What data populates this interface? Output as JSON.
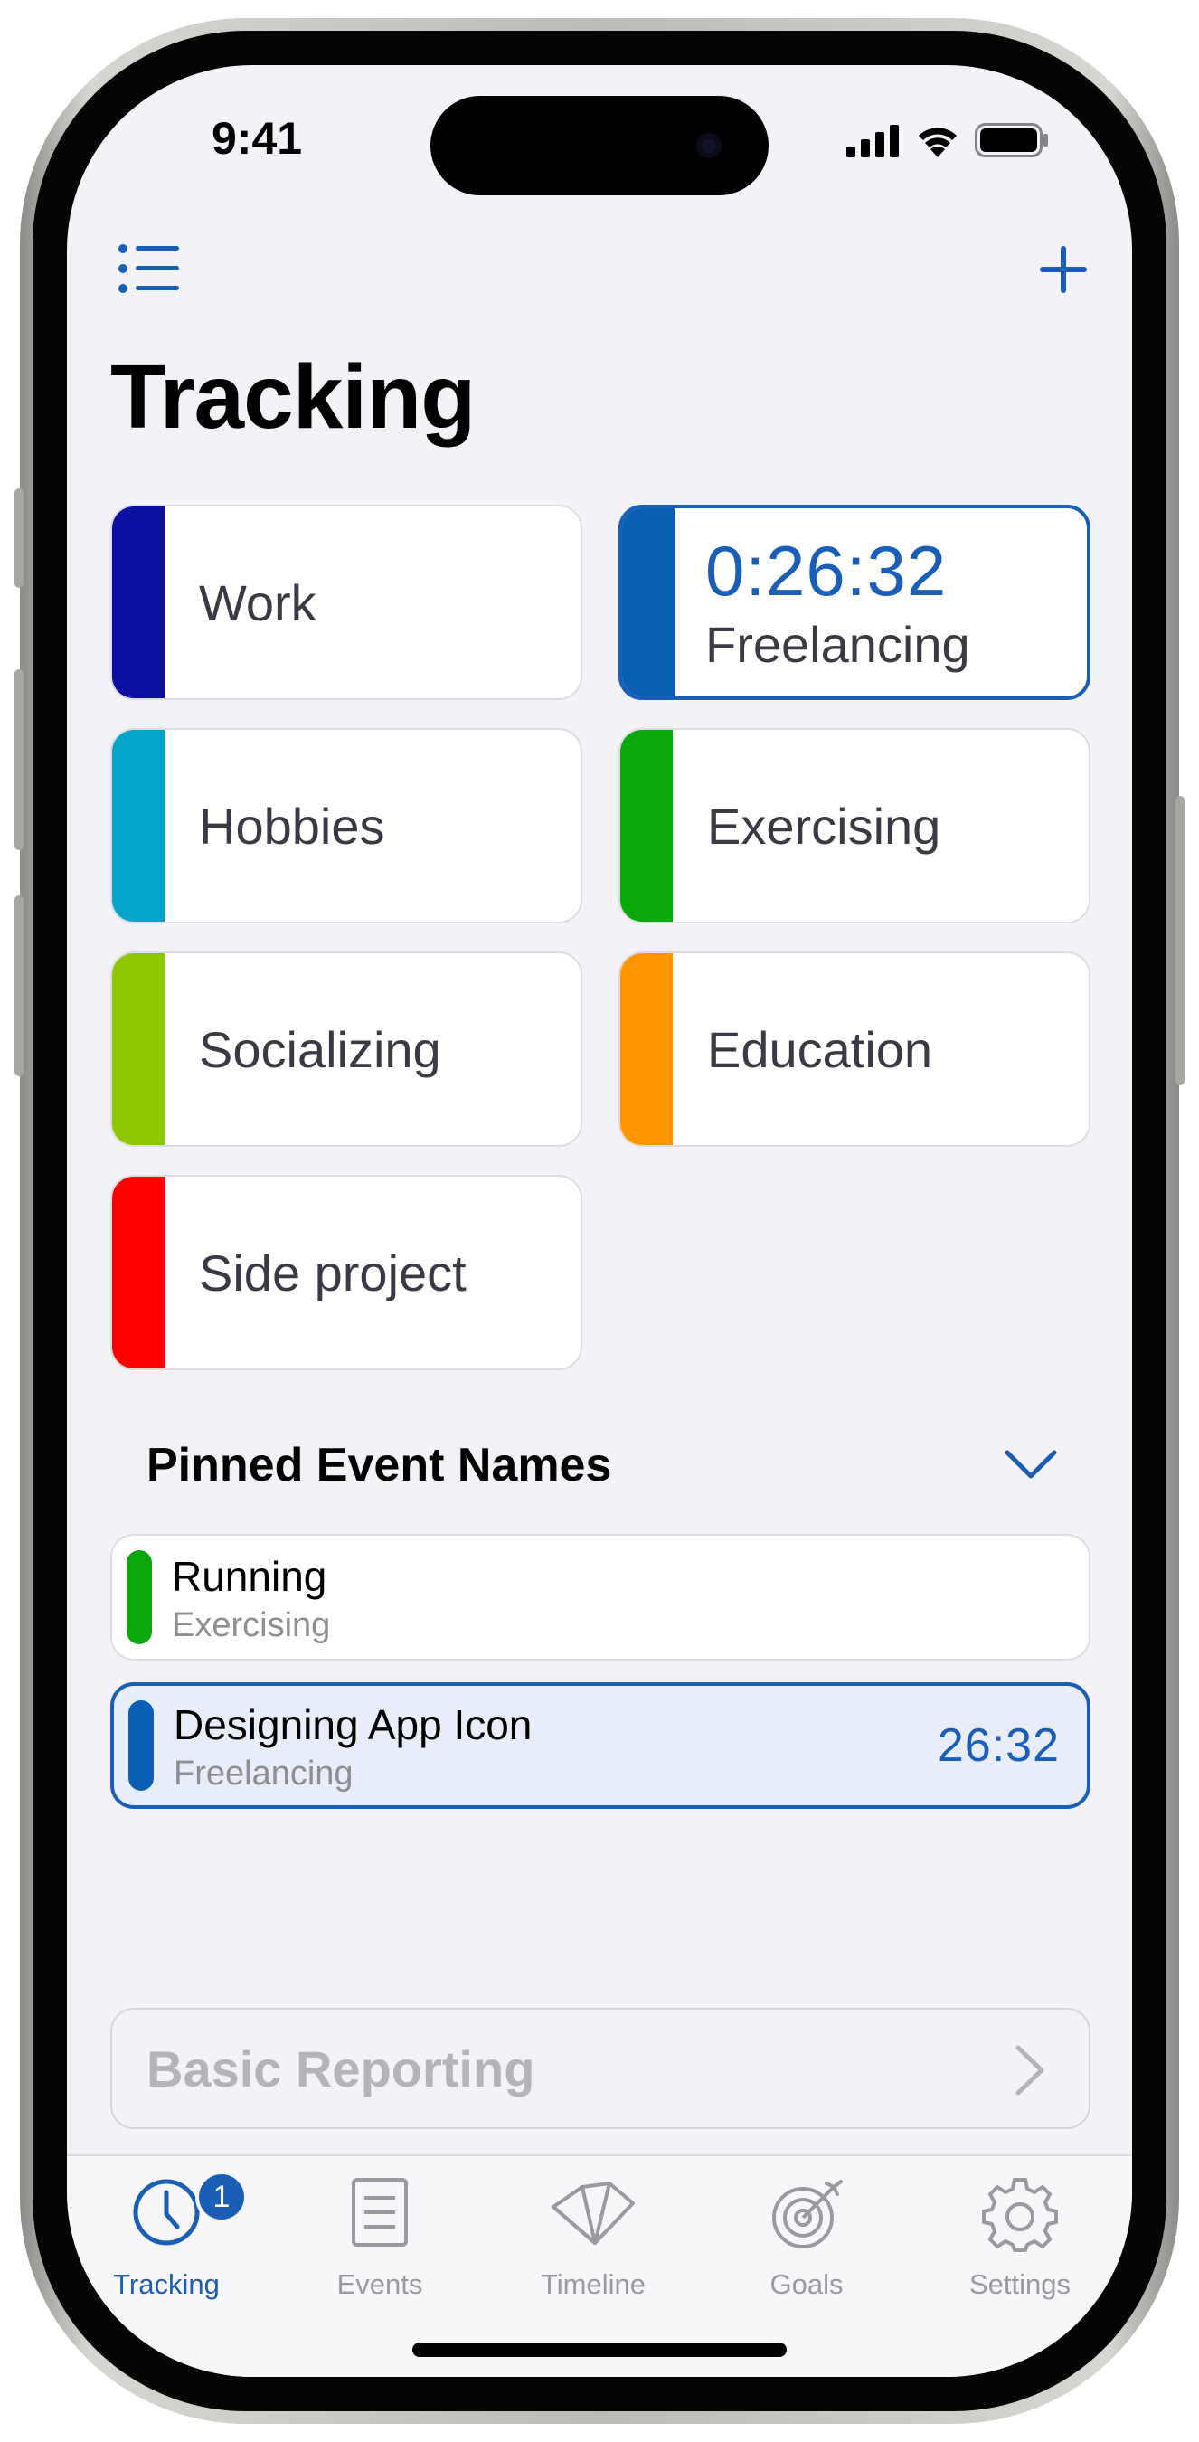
{
  "status_bar": {
    "time": "9:41"
  },
  "nav": {
    "menu_icon": "list-icon",
    "add_icon": "plus-icon"
  },
  "page_title": "Tracking",
  "categories": [
    {
      "label": "Work",
      "color": "#0a0fa0"
    },
    {
      "label": "Freelancing",
      "color": "#0a5fb5",
      "timer": "0:26:32",
      "active": true
    },
    {
      "label": "Hobbies",
      "color": "#05a4c8"
    },
    {
      "label": "Exercising",
      "color": "#0aa70a"
    },
    {
      "label": "Socializing",
      "color": "#8ec700"
    },
    {
      "label": "Education",
      "color": "#ff9500"
    },
    {
      "label": "Side project",
      "color": "#ff0000"
    }
  ],
  "pinned": {
    "title": "Pinned Event Names",
    "items": [
      {
        "name": "Running",
        "category": "Exercising",
        "color": "#0aa70a"
      },
      {
        "name": "Designing App Icon",
        "category": "Freelancing",
        "color": "#0a5fb5",
        "duration": "26:32",
        "active": true
      }
    ]
  },
  "reporting": {
    "label": "Basic Reporting"
  },
  "tabs": [
    {
      "label": "Tracking",
      "icon": "clock-icon",
      "badge": "1",
      "active": true
    },
    {
      "label": "Events",
      "icon": "document-icon"
    },
    {
      "label": "Timeline",
      "icon": "timeline-icon"
    },
    {
      "label": "Goals",
      "icon": "target-icon"
    },
    {
      "label": "Settings",
      "icon": "gear-icon"
    }
  ],
  "colors": {
    "accent": "#1a5fb5",
    "background": "#f2f2f7"
  }
}
